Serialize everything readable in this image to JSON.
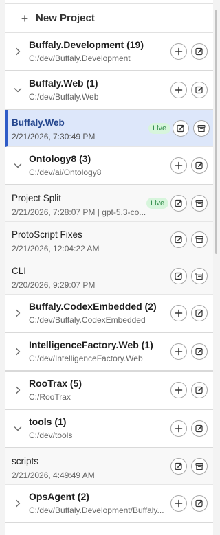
{
  "new_project_label": "New Project",
  "projects": [
    {
      "name": "Buffaly.Development (19)",
      "path": "C:/dev/Buffaly.Development",
      "expanded": false
    },
    {
      "name": "Buffaly.Web (1)",
      "path": "C:/dev/Buffaly.Web",
      "expanded": true,
      "sessions": [
        {
          "title": "Buffaly.Web",
          "subtitle": "2/21/2026, 7:30:49 PM",
          "live": "Live",
          "selected": true
        }
      ]
    },
    {
      "name": "Ontology8 (3)",
      "path": "C:/dev/ai/Ontology8",
      "expanded": true,
      "sessions": [
        {
          "title": "Project Split",
          "subtitle": "2/21/2026, 7:28:07 PM | gpt-5.3-co...",
          "live": "Live"
        },
        {
          "title": "ProtoScript Fixes",
          "subtitle": "2/21/2026, 12:04:22 AM"
        },
        {
          "title": "CLI",
          "subtitle": "2/20/2026, 9:29:07 PM"
        }
      ]
    },
    {
      "name": "Buffaly.CodexEmbedded (2)",
      "path": "C:/dev/Buffaly.CodexEmbedded",
      "expanded": false
    },
    {
      "name": "IntelligenceFactory.Web (1)",
      "path": "C:/dev/IntelligenceFactory.Web",
      "expanded": false
    },
    {
      "name": "RooTrax (5)",
      "path": "C:/RooTrax",
      "expanded": false
    },
    {
      "name": "tools (1)",
      "path": "C:/dev/tools",
      "expanded": true,
      "sessions": [
        {
          "title": "scripts",
          "subtitle": "2/21/2026, 4:49:49 AM"
        }
      ]
    },
    {
      "name": "OpsAgent (2)",
      "path": "C:/dev/Buffaly.Development/Buffaly...",
      "expanded": false
    }
  ]
}
